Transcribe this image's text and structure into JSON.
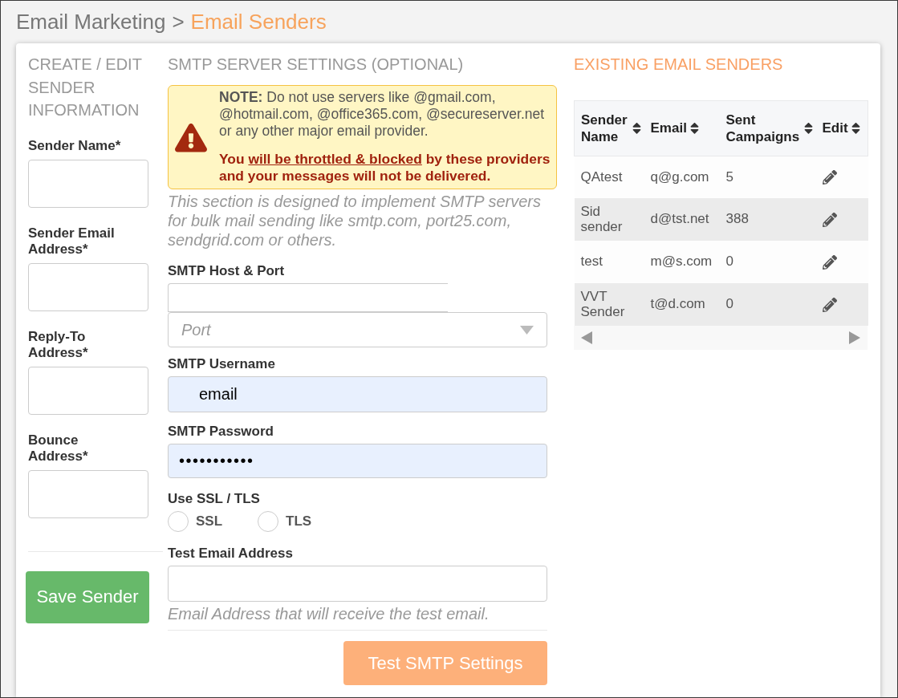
{
  "breadcrumb": {
    "parent": "Email Marketing",
    "separator": ">",
    "current": "Email Senders"
  },
  "sender_form": {
    "heading": "CREATE / EDIT SENDER INFORMATION",
    "fields": [
      {
        "label": "Sender Name*"
      },
      {
        "label": "Sender Email Address*"
      },
      {
        "label": "Reply-To Address*"
      },
      {
        "label": "Bounce Address*"
      }
    ],
    "save_button": "Save Sender"
  },
  "smtp_settings": {
    "heading": "SMTP SERVER SETTINGS (OPTIONAL)",
    "note": {
      "text": "**NOTE:** Do not use servers like @gmail.com, @hotmail.com, @office365.com, @secureserver.net or any other major email provider.",
      "warning_before": "You",
      "warning_underlined": "will be throttled & blocked",
      "warning_after": "by these providers and your messages will not be delivered."
    },
    "description": "This section is designed to implement SMTP servers for bulk mail sending like smtp.com, port25.com, sendgrid.com or others.",
    "fields": [
      {
        "kind": "host_port",
        "label": "SMTP Host & Port",
        "port_placeholder": "Port"
      },
      {
        "kind": "text",
        "label": "SMTP Username",
        "value": "email",
        "autofilled": true
      },
      {
        "kind": "password",
        "label": "SMTP Password",
        "value": "•••••••••••",
        "autofilled": true
      },
      {
        "kind": "radio_group",
        "label": "Use SSL / TLS",
        "options": [
          {
            "label": "SSL",
            "selected": false
          },
          {
            "label": "TLS",
            "selected": false
          }
        ]
      },
      {
        "kind": "text",
        "label": "Test Email Address",
        "autofilled": false,
        "help": "Email Address that will receive the test email."
      }
    ],
    "test_button": "Test SMTP Settings"
  },
  "existing_senders": {
    "heading": "EXISTING EMAIL SENDERS",
    "columns": [
      {
        "label": "Sender Name"
      },
      {
        "label": "Email"
      },
      {
        "label": "Sent Campaigns"
      },
      {
        "label": "Edit"
      }
    ],
    "rows": [
      {
        "name": "QAtest",
        "email": "q@g.com",
        "sent_campaigns": "5"
      },
      {
        "name": "Sid sender",
        "email": "d@tst.net",
        "sent_campaigns": "388"
      },
      {
        "name": "test",
        "email": "m@s.com",
        "sent_campaigns": "0"
      },
      {
        "name": "VVT Sender",
        "email": "t@d.com",
        "sent_campaigns": "0"
      }
    ]
  }
}
